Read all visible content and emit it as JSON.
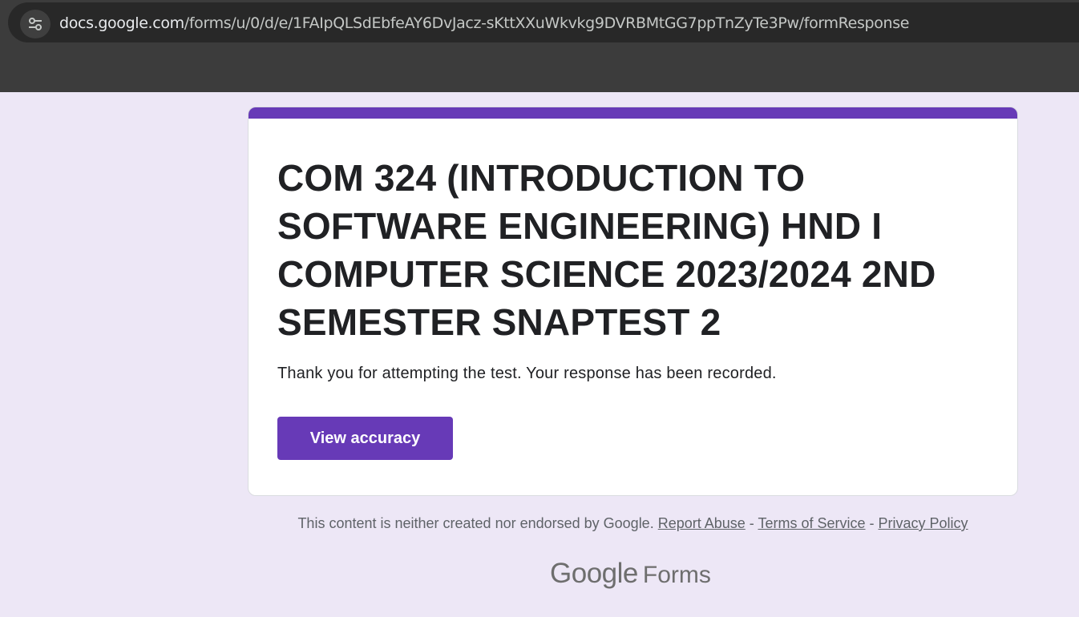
{
  "browser": {
    "url_host": "docs.google.com",
    "url_path": "/forms/u/0/d/e/1FAIpQLSdEbfeAY6DvJacz-sKttXXuWkvkg9DVRBMtGG7ppTnZyTe3Pw/formResponse",
    "site_info_icon": "tune-icon"
  },
  "form": {
    "accent_color": "#673ab7",
    "title": "COM 324 (INTRODUCTION TO SOFTWARE ENGINEERING) HND I COMPUTER SCIENCE 2023/2024 2ND SEMESTER SNAPTEST 2",
    "confirmation_message": "Thank you for attempting the test. Your response has been recorded.",
    "view_button_label": "View accuracy"
  },
  "footer": {
    "disclaimer": "This content is neither created nor endorsed by Google.",
    "separator": " - ",
    "links": {
      "report_abuse": "Report Abuse",
      "terms": "Terms of Service",
      "privacy": "Privacy Policy"
    },
    "brand_google": "Google",
    "brand_forms": "Forms"
  }
}
